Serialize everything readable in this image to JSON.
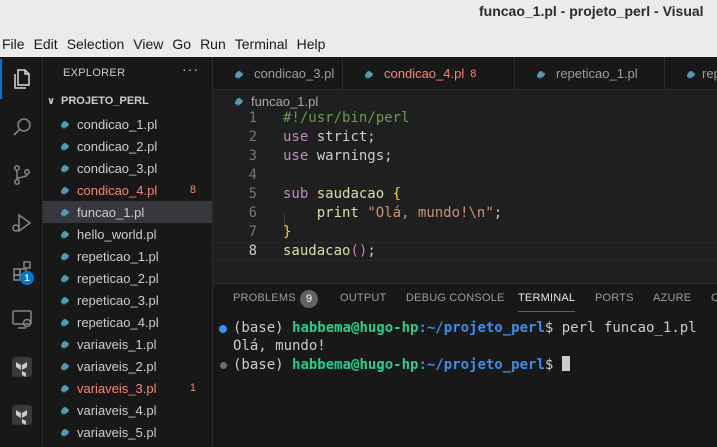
{
  "window": {
    "title": "funcao_1.pl - projeto_perl - Visual"
  },
  "menu": [
    "File",
    "Edit",
    "Selection",
    "View",
    "Go",
    "Run",
    "Terminal",
    "Help"
  ],
  "activity_bar": {
    "items": [
      "explorer-icon",
      "search-icon",
      "source-control-icon",
      "run-debug-icon",
      "extensions-icon",
      "remote-explorer-icon",
      "terraform-icon",
      "terraform-icon"
    ],
    "extensions_badge": "1"
  },
  "sidebar": {
    "header": "EXPLORER",
    "more": "···",
    "project": "PROJETO_PERL",
    "files": [
      {
        "name": "condicao_1.pl",
        "badge": ""
      },
      {
        "name": "condicao_2.pl",
        "badge": ""
      },
      {
        "name": "condicao_3.pl",
        "badge": ""
      },
      {
        "name": "condicao_4.pl",
        "badge": "8"
      },
      {
        "name": "funcao_1.pl",
        "badge": ""
      },
      {
        "name": "hello_world.pl",
        "badge": ""
      },
      {
        "name": "repeticao_1.pl",
        "badge": ""
      },
      {
        "name": "repeticao_2.pl",
        "badge": ""
      },
      {
        "name": "repeticao_3.pl",
        "badge": ""
      },
      {
        "name": "repeticao_4.pl",
        "badge": ""
      },
      {
        "name": "variaveis_1.pl",
        "badge": ""
      },
      {
        "name": "variaveis_2.pl",
        "badge": ""
      },
      {
        "name": "variaveis_3.pl",
        "badge": "1"
      },
      {
        "name": "variaveis_4.pl",
        "badge": ""
      },
      {
        "name": "variaveis_5.pl",
        "badge": ""
      }
    ]
  },
  "tabs": [
    {
      "label": "condicao_3.pl",
      "badge": ""
    },
    {
      "label": "condicao_4.pl",
      "badge": "8"
    },
    {
      "label": "repeticao_1.pl",
      "badge": ""
    },
    {
      "label": "repe",
      "badge": ""
    }
  ],
  "breadcrumb": "funcao_1.pl",
  "editor": {
    "line_numbers": [
      "1",
      "2",
      "3",
      "4",
      "5",
      "6",
      "7",
      "8"
    ],
    "lines": [
      [
        {
          "t": "#!/usr/bin/perl",
          "c": "comment"
        }
      ],
      [
        {
          "t": "use",
          "c": "kw"
        },
        {
          "t": " strict;",
          "c": "plain"
        }
      ],
      [
        {
          "t": "use",
          "c": "kw"
        },
        {
          "t": " warnings;",
          "c": "plain"
        }
      ],
      [],
      [
        {
          "t": "sub",
          "c": "kw"
        },
        {
          "t": " ",
          "c": "plain"
        },
        {
          "t": "saudacao",
          "c": "fn"
        },
        {
          "t": " ",
          "c": "plain"
        },
        {
          "t": "{",
          "c": "brace"
        }
      ],
      [
        {
          "t": "    ",
          "c": "plain"
        },
        {
          "t": "print",
          "c": "fn"
        },
        {
          "t": " ",
          "c": "plain"
        },
        {
          "t": "\"Olá, mundo!\\n\"",
          "c": "str"
        },
        {
          "t": ";",
          "c": "plain"
        }
      ],
      [
        {
          "t": "}",
          "c": "brace"
        }
      ],
      [
        {
          "t": "saudacao",
          "c": "fn"
        },
        {
          "t": "(",
          "c": "brace2"
        },
        {
          "t": ")",
          "c": "brace2"
        },
        {
          "t": ";",
          "c": "plain"
        }
      ]
    ]
  },
  "panel": {
    "tabs": [
      "PROBLEMS",
      "OUTPUT",
      "DEBUG CONSOLE",
      "TERMINAL",
      "PORTS",
      "AZURE",
      "C"
    ],
    "problems_count": "9",
    "terminal": {
      "prompt_prefix": "(base) ",
      "user": "habbema@hugo-hp",
      "path": ":~/projeto_perl",
      "dollar": "$ ",
      "command": "perl funcao_1.pl",
      "output": "Olá, mundo!"
    }
  },
  "colors": {
    "accent": "#0078d4",
    "error": "#f48771",
    "perl_icon": "#519aba"
  }
}
